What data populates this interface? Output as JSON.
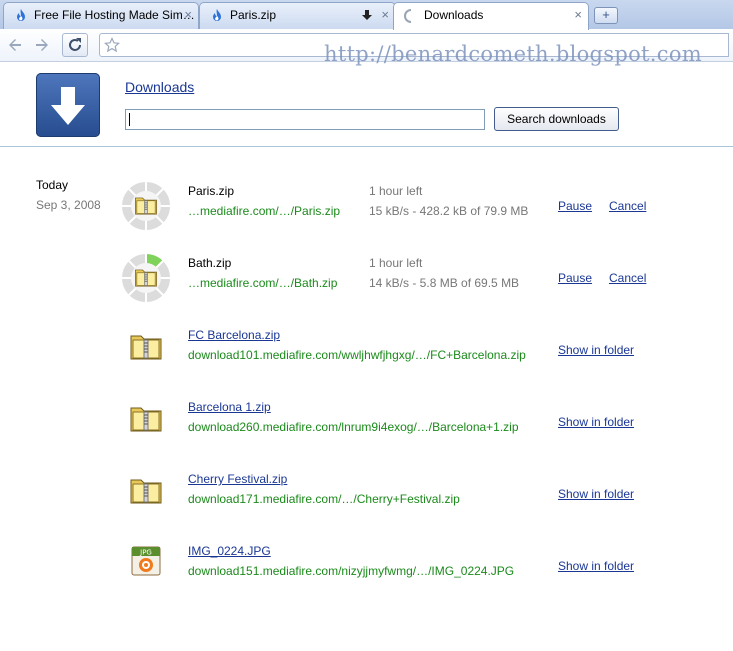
{
  "tabs": [
    {
      "title": "Free File Hosting Made Sim…",
      "icon": "flame-icon"
    },
    {
      "title": "Paris.zip",
      "icon": "flame-icon"
    },
    {
      "title": "Downloads",
      "icon": "loading-spinner-icon",
      "active": true
    }
  ],
  "tab_close": "×",
  "new_tab_symbol": "+",
  "watermark": "http://benardcometh.blogspot.com",
  "page": {
    "title": "Downloads",
    "search_value": "",
    "search_button": "Search downloads"
  },
  "date": {
    "today": "Today",
    "full": "Sep 3, 2008"
  },
  "downloads": [
    {
      "name": "Paris.zip",
      "url": "…mediafire.com/…/Paris.zip",
      "status": "1 hour left",
      "progress_text": "15 kB/s - 428.2 kB of 79.9 MB",
      "state": "in-progress",
      "progress": 0.005,
      "actions": [
        "Pause",
        "Cancel"
      ],
      "icon": "zip-file-icon"
    },
    {
      "name": "Bath.zip",
      "url": "…mediafire.com/…/Bath.zip",
      "status": "1 hour left",
      "progress_text": "14 kB/s - 5.8 MB of 69.5 MB",
      "state": "in-progress",
      "progress": 0.083,
      "actions": [
        "Pause",
        "Cancel"
      ],
      "icon": "zip-file-icon"
    },
    {
      "name": "FC Barcelona.zip",
      "url": "download101.mediafire.com/wwljhwfjhgxg/…/FC+Barcelona.zip",
      "state": "complete",
      "actions": [
        "Show in folder"
      ],
      "icon": "zip-file-icon"
    },
    {
      "name": "Barcelona 1.zip",
      "url": "download260.mediafire.com/lnrum9i4exog/…/Barcelona+1.zip",
      "state": "complete",
      "actions": [
        "Show in folder"
      ],
      "icon": "zip-file-icon"
    },
    {
      "name": "Cherry Festival.zip",
      "url": "download171.mediafire.com/…/Cherry+Festival.zip",
      "state": "complete",
      "actions": [
        "Show in folder"
      ],
      "icon": "zip-file-icon"
    },
    {
      "name": "IMG_0224.JPG",
      "url": "download151.mediafire.com/nizyjjmyfwmg/…/IMG_0224.JPG",
      "state": "complete",
      "actions": [
        "Show in folder"
      ],
      "icon": "jpg-file-icon",
      "icon_label": "JPG"
    }
  ],
  "colors": {
    "link": "#1a3794",
    "url_green": "#1b8a1b",
    "status_gray": "#777777",
    "progress_green": "#7fd35a"
  }
}
